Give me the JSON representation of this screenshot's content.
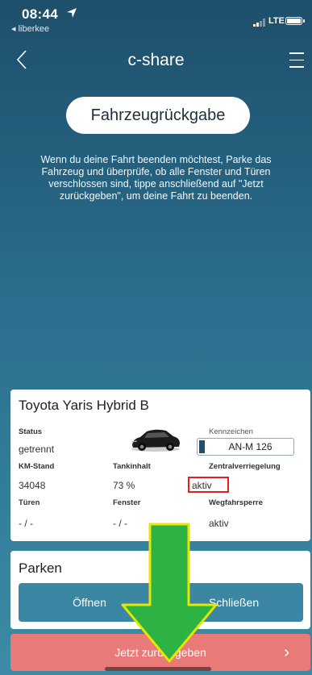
{
  "status_bar": {
    "time": "08:44",
    "back_app": "◂ liberkee",
    "network": "LTE"
  },
  "nav": {
    "title": "c-share"
  },
  "page": {
    "heading": "Fahrzeugrückgabe",
    "intro": "Wenn du deine Fahrt beenden möchtest, Parke das Fahrzeug und überprüfe, ob alle Fenster und Türen verschlossen sind, tippe anschließend auf \"Jetzt zurückgeben\", um deine Fahrt zu beenden."
  },
  "vehicle": {
    "name": "Toyota Yaris Hybrid B",
    "status_label": "Status",
    "status_value": "getrennt",
    "plate_label": "Kennzeichen",
    "plate_value": "AN-M 126",
    "km_label": "KM-Stand",
    "km_value": "34048",
    "tank_label": "Tankinhalt",
    "tank_value": "73 %",
    "lock_label": "Zentralverriegelung",
    "lock_value": "aktiv",
    "doors_label": "Türen",
    "doors_value": "- / -",
    "windows_label": "Fenster",
    "windows_value": "- / -",
    "immobilizer_label": "Wegfahrsperre",
    "immobilizer_value": "aktiv"
  },
  "parking": {
    "title": "Parken",
    "open_label": "Öffnen",
    "close_label": "Schließen"
  },
  "return_button": {
    "label": "Jetzt zurückgeben"
  },
  "colors": {
    "accent": "#3b87a3",
    "return": "#e87b78",
    "highlight_box": "#e02020",
    "arrow_fill": "#2db344",
    "arrow_stroke": "#e6e600"
  }
}
